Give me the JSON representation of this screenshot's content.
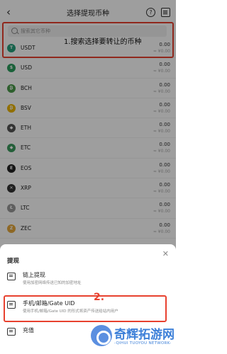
{
  "header": {
    "title": "选择提现币种",
    "back_icon": "back-arrow-icon",
    "help_icon": "help-icon",
    "history_icon": "history-icon"
  },
  "search": {
    "placeholder": "搜索其它币种"
  },
  "annotations": {
    "step1": "1.搜索选择要转让的币种",
    "step2": "2."
  },
  "coins": [
    {
      "symbol": "USDT",
      "amount": "0.00",
      "sub": "≈ ¥0.00",
      "color": "#26a17b",
      "icon": "T"
    },
    {
      "symbol": "USD",
      "amount": "0.00",
      "sub": "≈ ¥0.00",
      "color": "#2a9d5c",
      "icon": "$"
    },
    {
      "symbol": "BCH",
      "amount": "0.00",
      "sub": "≈ ¥0.00",
      "color": "#4a9a4a",
      "icon": "₿"
    },
    {
      "symbol": "BSV",
      "amount": "0.00",
      "sub": "≈ ¥0.00",
      "color": "#eab300",
      "icon": "₿"
    },
    {
      "symbol": "ETH",
      "amount": "0.00",
      "sub": "≈ ¥0.00",
      "color": "#555555",
      "icon": "◆"
    },
    {
      "symbol": "ETC",
      "amount": "0.00",
      "sub": "≈ ¥0.00",
      "color": "#3a9a5c",
      "icon": "◆"
    },
    {
      "symbol": "EOS",
      "amount": "0.00",
      "sub": "≈ ¥0.00",
      "color": "#222222",
      "icon": "E"
    },
    {
      "symbol": "XRP",
      "amount": "0.00",
      "sub": "≈ ¥0.00",
      "color": "#333333",
      "icon": "✕"
    },
    {
      "symbol": "LTC",
      "amount": "0.00",
      "sub": "≈ ¥0.00",
      "color": "#9a9a9a",
      "icon": "Ł"
    },
    {
      "symbol": "ZEC",
      "amount": "0.00",
      "sub": "≈ ¥0.00",
      "color": "#e5a93d",
      "icon": "Z"
    }
  ],
  "sheet": {
    "title": "提现",
    "close_icon": "close-icon",
    "options": [
      {
        "label": "链上提现",
        "desc": "使用加密网络传送已知的加密地址"
      },
      {
        "label": "手机/邮箱/Gate UID",
        "desc": "使用手机/邮箱/Gate UID 的形式将资产传送给站内用户"
      },
      {
        "label": "充值",
        "desc": ""
      }
    ]
  },
  "watermark": {
    "text": "奇辉拓游网",
    "sub": "-QIHUI TUOYOU NETWORK-"
  },
  "colors": {
    "accent_red": "#e8412f",
    "watermark_blue": "#3c7fd8"
  }
}
